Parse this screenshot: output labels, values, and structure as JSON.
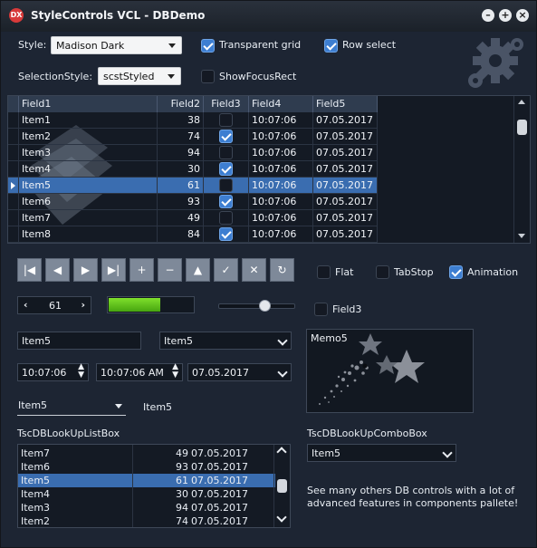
{
  "window": {
    "title": "StyleControls VCL - DBDemo",
    "icon_text": "DX"
  },
  "toolbar": {
    "style_label": "Style:",
    "style_value": "Madison Dark",
    "selection_style_label": "SelectionStyle:",
    "selection_style_value": "scstStyled",
    "transparent_grid_label": "Transparent grid",
    "transparent_grid_checked": true,
    "row_select_label": "Row select",
    "row_select_checked": true,
    "show_focus_rect_label": "ShowFocusRect",
    "show_focus_rect_checked": false
  },
  "grid": {
    "columns": [
      "Field1",
      "Field2",
      "Field3",
      "Field4",
      "Field5"
    ],
    "rows": [
      {
        "field1": "Item1",
        "field2": "38",
        "field3": false,
        "field4": "10:07:06",
        "field5": "07.05.2017"
      },
      {
        "field1": "Item2",
        "field2": "74",
        "field3": true,
        "field4": "10:07:06",
        "field5": "07.05.2017"
      },
      {
        "field1": "Item3",
        "field2": "94",
        "field3": false,
        "field4": "10:07:06",
        "field5": "07.05.2017"
      },
      {
        "field1": "Item4",
        "field2": "30",
        "field3": true,
        "field4": "10:07:06",
        "field5": "07.05.2017"
      },
      {
        "field1": "Item5",
        "field2": "61",
        "field3": false,
        "field4": "10:07:06",
        "field5": "07.05.2017"
      },
      {
        "field1": "Item6",
        "field2": "93",
        "field3": true,
        "field4": "10:07:06",
        "field5": "07.05.2017"
      },
      {
        "field1": "Item7",
        "field2": "49",
        "field3": false,
        "field4": "10:07:06",
        "field5": "07.05.2017"
      },
      {
        "field1": "Item8",
        "field2": "84",
        "field3": true,
        "field4": "10:07:06",
        "field5": "07.05.2017"
      }
    ],
    "selected_row": 4
  },
  "navigator": {
    "buttons": [
      "first",
      "prior",
      "next",
      "last",
      "insert",
      "delete",
      "edit",
      "post",
      "cancel",
      "refresh"
    ],
    "glyphs": [
      "|◀",
      "◀",
      "▶",
      "▶|",
      "+",
      "−",
      "▲",
      "✓",
      "✕",
      "↻"
    ]
  },
  "options": {
    "flat_label": "Flat",
    "flat_checked": false,
    "tabstop_label": "TabStop",
    "tabstop_checked": false,
    "animation_label": "Animation",
    "animation_checked": true,
    "field3_label": "Field3",
    "field3_checked": false
  },
  "spin": {
    "value": "61"
  },
  "progress": {
    "value_fraction": 0.6
  },
  "slider": {
    "value_fraction": 0.6
  },
  "edits": {
    "edit1": "Item5",
    "combo1": "Item5",
    "time1": "10:07:06",
    "datetime1": "10:07:06 AM",
    "date1": "07.05.2017",
    "combo2": "Item5",
    "label_item5": "Item5",
    "memo": "Memo5"
  },
  "lookup_listbox": {
    "label": "TscDBLookUpListBox",
    "items": [
      {
        "name": "Item7",
        "num": "49",
        "date": "07.05.2017"
      },
      {
        "name": "Item6",
        "num": "93",
        "date": "07.05.2017"
      },
      {
        "name": "Item5",
        "num": "61",
        "date": "07.05.2017"
      },
      {
        "name": "Item4",
        "num": "30",
        "date": "07.05.2017"
      },
      {
        "name": "Item3",
        "num": "94",
        "date": "07.05.2017"
      },
      {
        "name": "Item2",
        "num": "74",
        "date": "07.05.2017"
      }
    ],
    "selected": 2
  },
  "lookup_combobox": {
    "label": "TscDBLookUpComboBox",
    "value": "Item5"
  },
  "info_text_line1": "See many others DB controls with a lot of",
  "info_text_line2": "advanced features in components pallete!",
  "colors": {
    "accent": "#3a6db0",
    "progress": "#5ec21c",
    "background": "#1d2533"
  },
  "icons": [
    "app-icon",
    "minimize-icon",
    "maximize-icon",
    "close-icon",
    "gear-icon",
    "folder-icon",
    "star-icon"
  ]
}
